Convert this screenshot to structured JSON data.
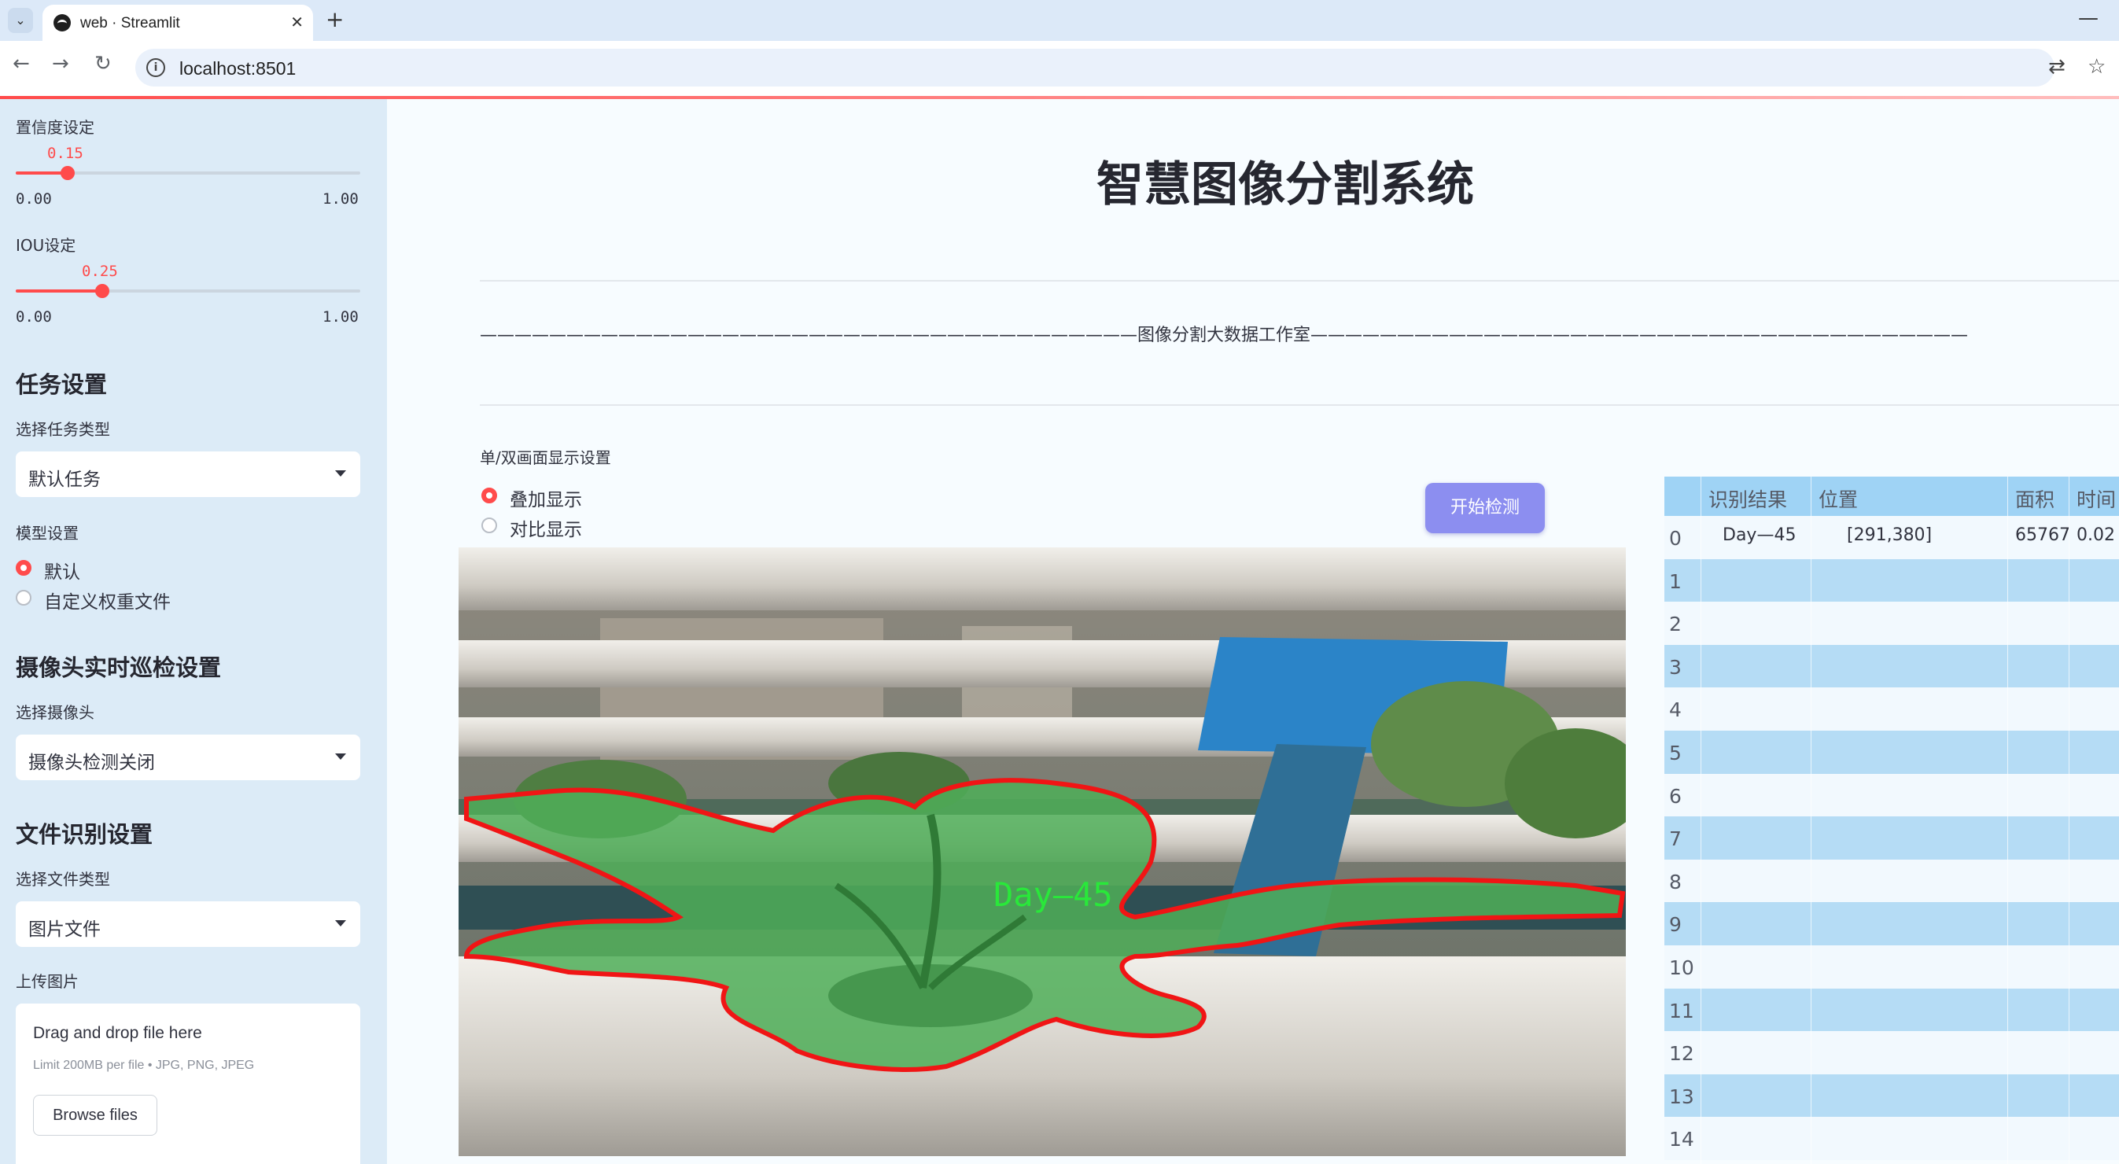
{
  "browser": {
    "tab_title": "web · Streamlit",
    "url": "localhost:8501"
  },
  "sidebar": {
    "confidence": {
      "label": "置信度设定",
      "value": "0.15",
      "fraction": 0.15,
      "min": "0.00",
      "max": "1.00"
    },
    "iou": {
      "label": "IOU设定",
      "value": "0.25",
      "fraction": 0.25,
      "min": "0.00",
      "max": "1.00"
    },
    "task_heading": "任务设置",
    "task_type_label": "选择任务类型",
    "task_type_value": "默认任务",
    "model_label": "模型设置",
    "model_options": [
      "默认",
      "自定义权重文件"
    ],
    "camera_heading": "摄像头实时巡检设置",
    "camera_label": "选择摄像头",
    "camera_value": "摄像头检测关闭",
    "file_heading": "文件识别设置",
    "file_type_label": "选择文件类型",
    "file_type_value": "图片文件",
    "upload_label": "上传图片",
    "upload_title": "Drag and drop file here",
    "upload_limit": "Limit 200MB per file • JPG, PNG, JPEG",
    "browse_button": "Browse files"
  },
  "main": {
    "title": "智慧图像分割系统",
    "studio_line": "——————————————————————————————————————图像分割大数据工作室——————————————————————————————————————",
    "display_label": "单/双画面显示设置",
    "display_options": [
      "叠加显示",
      "对比显示"
    ],
    "start_button": "开始检测",
    "detection_label": "Day—45"
  },
  "table": {
    "headers": [
      "识别结果",
      "位置",
      "面积",
      "时间"
    ],
    "row_indices": [
      "0",
      "1",
      "2",
      "3",
      "4",
      "5",
      "6",
      "7",
      "8",
      "9",
      "10",
      "11",
      "12",
      "13",
      "14"
    ],
    "first_row": {
      "result": "Day—45",
      "position": "[291,380]",
      "area": "65767",
      "time": "0.02"
    }
  },
  "colors": {
    "accent": "#ff4b4b",
    "button": "#8c8ef0",
    "sidebar_bg": "#dcebf7",
    "table_header": "#9fd3f5"
  }
}
